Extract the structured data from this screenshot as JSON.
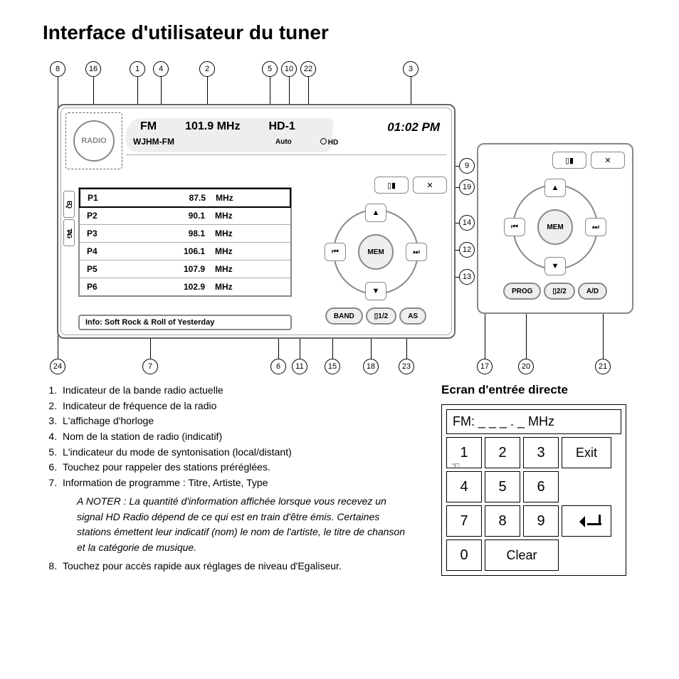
{
  "title": "Interface d'utilisateur du tuner",
  "callouts_top": [
    "8",
    "16",
    "1",
    "4",
    "2",
    "5",
    "10",
    "22",
    "3"
  ],
  "callouts_right": [
    "9",
    "19",
    "14",
    "12",
    "13"
  ],
  "callouts_bottom_left": [
    "24",
    "7",
    "6",
    "11",
    "15",
    "18",
    "23"
  ],
  "callouts_bottom_right": [
    "17",
    "20",
    "21"
  ],
  "radio": {
    "knob_label": "RADIO",
    "band": "FM",
    "frequency": "101.9 MHz",
    "hd": "HD-1",
    "station": "WJHM-FM",
    "mode": "Auto",
    "hd_label": "HD",
    "clock": "01:02 PM",
    "side_tabs": [
      "EQ",
      "TAG"
    ],
    "presets": [
      {
        "label": "P1",
        "freq": "87.5",
        "unit": "MHz"
      },
      {
        "label": "P2",
        "freq": "90.1",
        "unit": "MHz"
      },
      {
        "label": "P3",
        "freq": "98.1",
        "unit": "MHz"
      },
      {
        "label": "P4",
        "freq": "106.1",
        "unit": "MHz"
      },
      {
        "label": "P5",
        "freq": "107.9",
        "unit": "MHz"
      },
      {
        "label": "P6",
        "freq": "102.9",
        "unit": "MHz"
      }
    ],
    "info": "Info: Soft Rock & Roll of Yesterday",
    "icons": {
      "battery": "▯▮",
      "tools": "✕"
    },
    "dpad": {
      "center": "MEM",
      "up": "▲",
      "down": "▼",
      "left": "⏮",
      "right": "⏭"
    },
    "buttons1": {
      "band": "BAND",
      "page": "1/2",
      "as": "AS"
    },
    "buttons2": {
      "prog": "PROG",
      "page": "2/2",
      "ad": "A/D"
    }
  },
  "legend_title": "",
  "legend": [
    "Indicateur de la bande radio actuelle",
    "Indicateur de fréquence de la radio",
    "L'affichage d'horloge",
    "Nom de la station de radio (indicatif)",
    "L'indicateur du mode de syntonisation (local/distant)",
    "Touchez pour rappeler des stations préréglées.",
    "Information de programme : Titre, Artiste, Type",
    "Touchez pour accès rapide aux réglages de niveau d'Egaliseur."
  ],
  "legend_note": "A NOTER : La quantité d'information affichée lorsque vous recevez un signal HD Radio dépend de ce qui est en train d'être émis. Certaines stations émettent leur indicatif (nom) le nom de l'artiste, le titre de chanson et la catégorie de musique.",
  "keypad": {
    "title": "Ecran d'entrée directe",
    "display": "FM: _ _ _ . _  MHz",
    "keys": [
      "1",
      "2",
      "3",
      "Exit",
      "4",
      "5",
      "6",
      "7",
      "8",
      "9",
      "0",
      "Clear"
    ],
    "enter_icon": "↵"
  }
}
